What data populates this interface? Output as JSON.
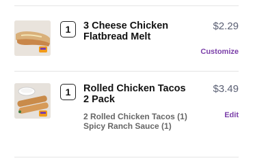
{
  "cart": {
    "items": [
      {
        "quantity": "1",
        "name_line1": "3 Cheese Chicken",
        "name_line2": "Flatbread Melt",
        "price": "$2.29",
        "action": "Customize",
        "image": "flatbread-melt-image"
      },
      {
        "quantity": "1",
        "name_line1": "Rolled Chicken Tacos",
        "name_line2": "2 Pack",
        "price": "$3.49",
        "action": "Edit",
        "image": "rolled-tacos-image",
        "details": [
          "2 Rolled Chicken Tacos (1)",
          "Spicy Ranch Sauce (1)"
        ]
      }
    ]
  }
}
